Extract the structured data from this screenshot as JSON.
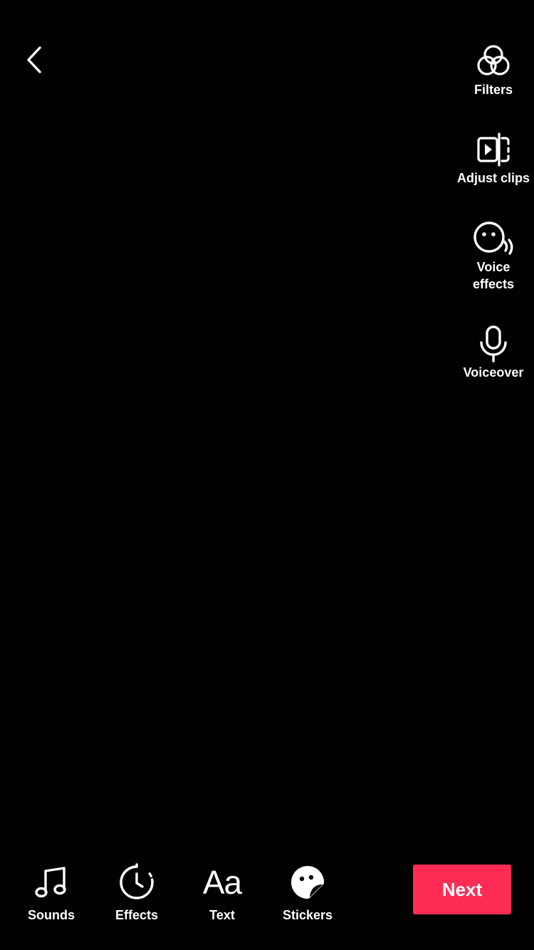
{
  "screen": {
    "background_color": "#020102",
    "accent_color": "#fe2c55"
  },
  "header": {
    "back_icon": "chevron-left-icon"
  },
  "side_tools": {
    "filters": {
      "label": "Filters",
      "icon": "filters-icon"
    },
    "adjust_clips": {
      "label": "Adjust clips",
      "icon": "adjust-clips-icon"
    },
    "voice_effects": {
      "label_line1": "Voice",
      "label_line2": "effects",
      "icon": "voice-effects-icon"
    },
    "voiceover": {
      "label": "Voiceover",
      "icon": "microphone-icon"
    }
  },
  "bottom_tools": {
    "sounds": {
      "label": "Sounds",
      "icon": "music-note-icon"
    },
    "effects": {
      "label": "Effects",
      "icon": "effects-timer-icon"
    },
    "text": {
      "label": "Text",
      "glyph": "Aa",
      "icon": "text-icon"
    },
    "stickers": {
      "label": "Stickers",
      "icon": "sticker-icon"
    }
  },
  "actions": {
    "next_label": "Next"
  }
}
